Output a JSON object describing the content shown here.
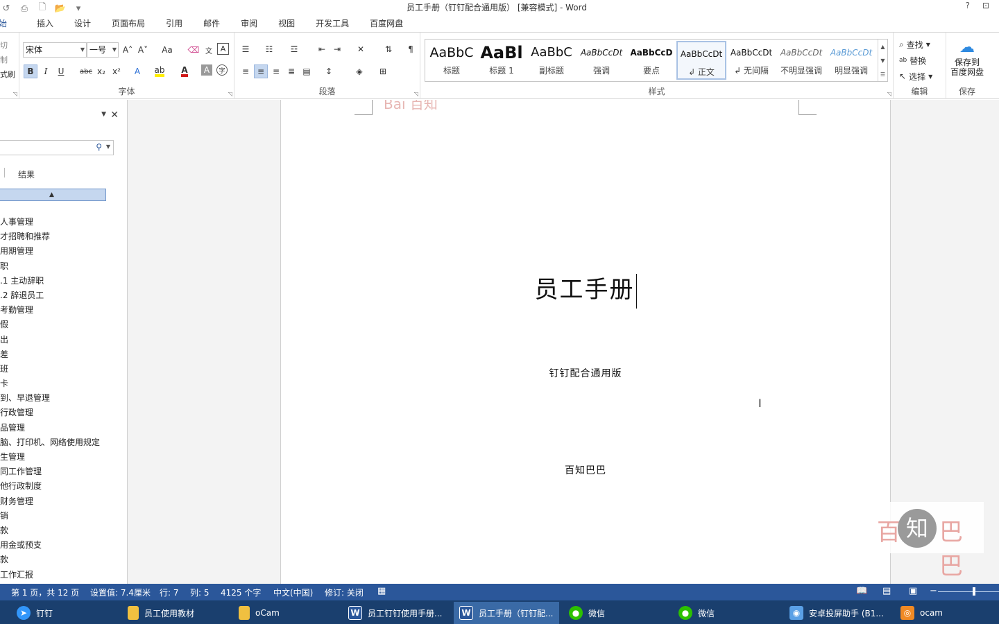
{
  "window": {
    "title": "员工手册（钉钉配合通用版） [兼容模式] - Word",
    "help": "?",
    "restore": "⊡"
  },
  "qat": {
    "undo": "↺",
    "print_preview": "⎙",
    "new": "🗋",
    "open": "📂",
    "more": "▾"
  },
  "tabs": [
    "始",
    "插入",
    "设计",
    "页面布局",
    "引用",
    "邮件",
    "审阅",
    "视图",
    "开发工具",
    "百度网盘"
  ],
  "ribbon": {
    "clipboard_partial": [
      "切",
      "制",
      "式刷"
    ],
    "font": {
      "name": "宋体",
      "size": "一号",
      "grow": "A˄",
      "shrink": "A˅",
      "case": "Aa",
      "bold": "B",
      "italic": "I",
      "underline": "U",
      "strike": "abc",
      "subscript": "x₂",
      "superscript": "x²",
      "group_label": "字体"
    },
    "paragraph": {
      "group_label": "段落"
    },
    "styles": {
      "group_label": "样式",
      "items": [
        {
          "sample": "AaBbC",
          "name": "标题"
        },
        {
          "sample": "AaBl",
          "name": "标题 1"
        },
        {
          "sample": "AaBbC",
          "name": "副标题"
        },
        {
          "sample": "AaBbCcDt",
          "name": "强调"
        },
        {
          "sample": "AaBbCcD",
          "name": "要点"
        },
        {
          "sample": "AaBbCcDt",
          "name": "↲ 正文"
        },
        {
          "sample": "AaBbCcDt",
          "name": "↲ 无间隔"
        },
        {
          "sample": "AaBbCcDt",
          "name": "不明显强调"
        },
        {
          "sample": "AaBbCcDt",
          "name": "明显强调"
        }
      ]
    },
    "editing": {
      "find": "查找",
      "replace": "替换",
      "select": "选择",
      "group_label": "编辑"
    },
    "save": {
      "label_line1": "保存到",
      "label_line2": "百度网盘",
      "group_label": "保存"
    }
  },
  "nav": {
    "results_tab": "结果",
    "items": [
      "人事管理",
      "才招聘和推荐",
      "用期管理",
      "职",
      ".1 主动辞职",
      ".2 辞退员工",
      "考勤管理",
      "假",
      "出",
      "差",
      "班",
      "卡",
      "到、早退管理",
      "行政管理",
      "品管理",
      "脑、打印机、网络使用规定",
      "生管理",
      "同工作管理",
      "他行政制度",
      "财务管理",
      "销",
      "款",
      "用金或预支",
      "款",
      "工作汇报"
    ]
  },
  "document": {
    "title": "员工手册",
    "subtitle": "钉钉配合通用版",
    "author": "百知巴巴"
  },
  "watermark": {
    "left": "百",
    "mid": "知",
    "right": "巴巴",
    "top_partial": "Bai 百知"
  },
  "status": {
    "page": "第 1 页，共 12 页",
    "position": "设置值: 7.4厘米",
    "line": "行: 7",
    "column": "列: 5",
    "words": "4125 个字",
    "language": "中文(中国)",
    "track": "修订: 关闭"
  },
  "taskbar": [
    {
      "label": "钉钉",
      "icon": "dingtalk-icon",
      "color": "#3296fa"
    },
    {
      "label": "员工使用教材",
      "icon": "folder-icon",
      "color": "#f0c040"
    },
    {
      "label": "oCam",
      "icon": "folder-icon",
      "color": "#f0c040"
    },
    {
      "label": "员工钉钉使用手册...",
      "icon": "word-icon",
      "color": "#2b579a"
    },
    {
      "label": "员工手册（钉钉配...",
      "icon": "word-icon",
      "color": "#2b579a"
    },
    {
      "label": "微信",
      "icon": "wechat-icon",
      "color": "#2dc100"
    },
    {
      "label": "微信",
      "icon": "wechat-icon",
      "color": "#2dc100"
    },
    {
      "label": "安卓投屏助手 (B1...",
      "icon": "android-icon",
      "color": "#5aa0e6"
    },
    {
      "label": "ocam",
      "icon": "ocam-icon",
      "color": "#f08a24"
    }
  ],
  "colors": {
    "accent": "#2b579a",
    "taskbar": "#1a3f6e"
  }
}
